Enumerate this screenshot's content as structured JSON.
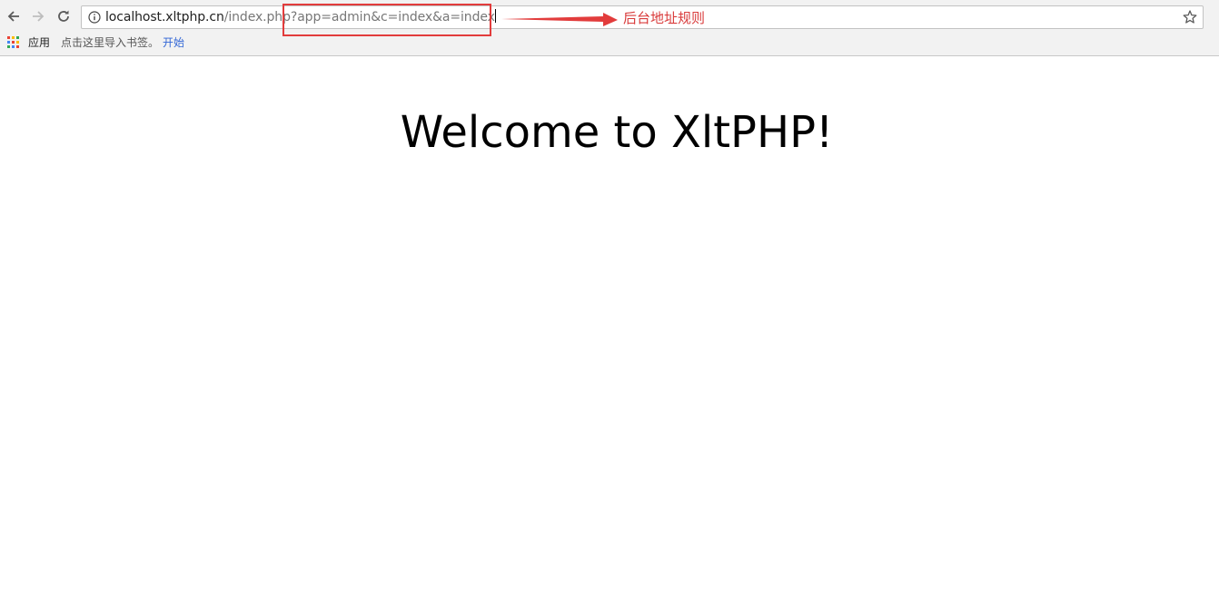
{
  "browser": {
    "url": {
      "host": "localhost.xltphp.cn",
      "path": "/index.php",
      "query": "?app=admin&c=index&a=index"
    },
    "bookmarks": {
      "apps_label": "应用",
      "import_hint": "点击这里导入书签。",
      "start_link": "开始"
    }
  },
  "annotation": {
    "label": "后台地址规则",
    "color": "#e23c3c"
  },
  "page": {
    "heading": "Welcome to XltPHP!"
  },
  "icons": {
    "back": "back-arrow-icon",
    "forward": "forward-arrow-icon",
    "reload": "reload-icon",
    "info": "info-icon",
    "star": "star-icon",
    "apps": "apps-grid-icon"
  }
}
